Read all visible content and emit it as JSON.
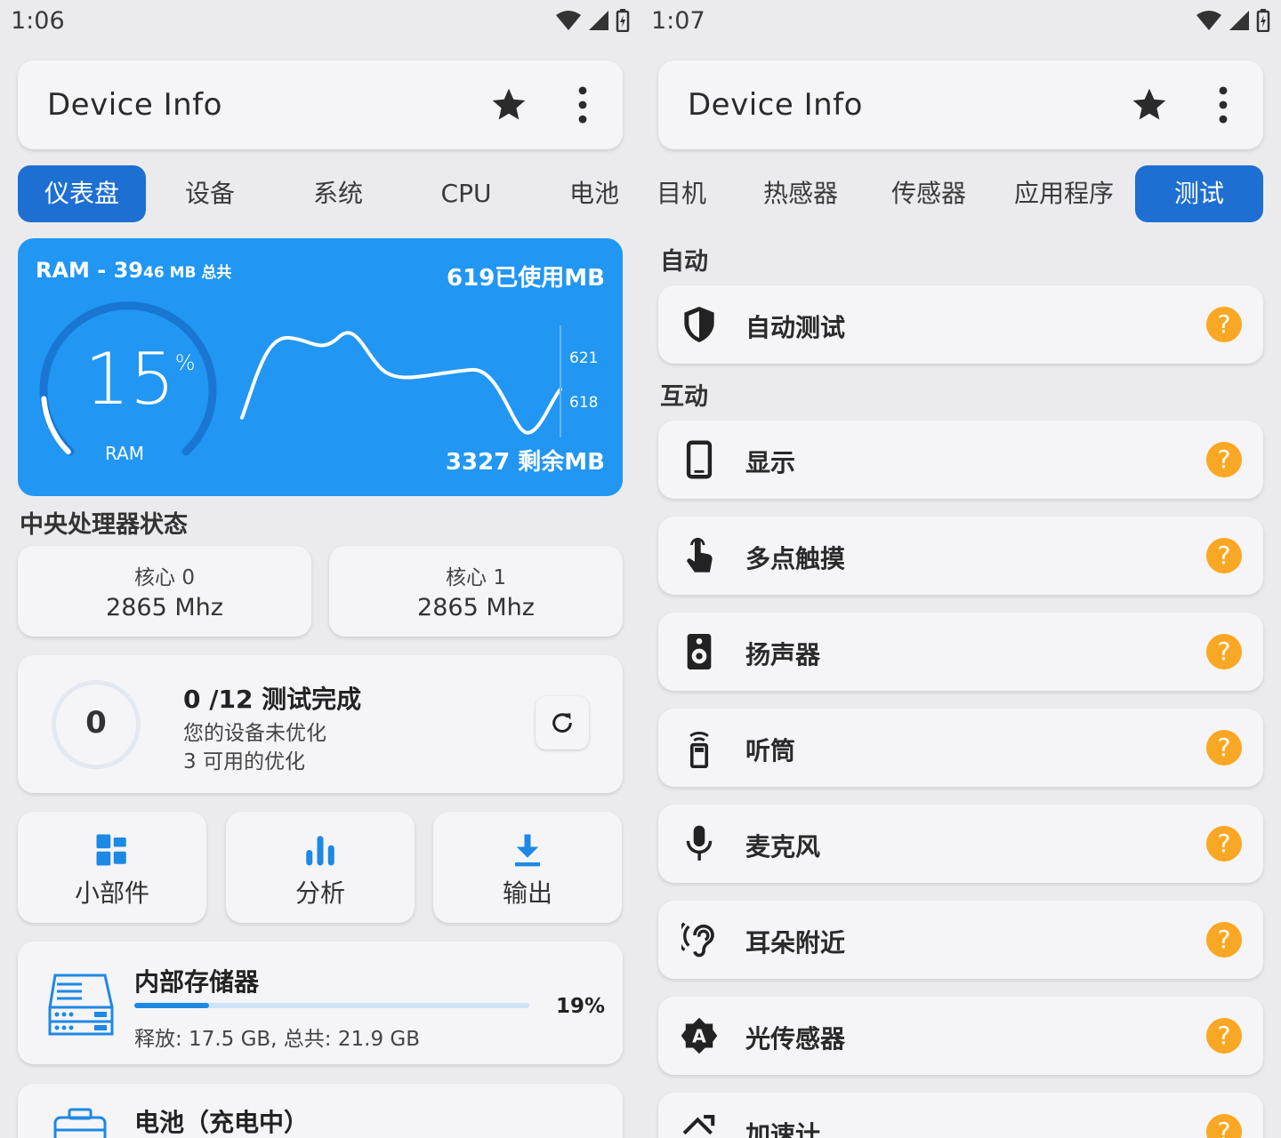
{
  "left": {
    "time": "1:06",
    "app_title": "Device Info",
    "tabs": [
      "仪表盘",
      "设备",
      "系统",
      "CPU",
      "电池"
    ],
    "active_tab": "仪表盘",
    "ram": {
      "title": "RAM - 39",
      "title_small": "46 MB 总共",
      "used": "619已使用MB",
      "free": "3327 剩余MB",
      "percent": "15",
      "percent_sign": "%",
      "label": "RAM",
      "tick_high": "621",
      "tick_low": "618",
      "gauge_fraction": 0.15
    },
    "cpu_section_title": "中央处理器状态",
    "cores": [
      {
        "label": "核心 0",
        "value": "2865 Mhz"
      },
      {
        "label": "核心 1",
        "value": "2865 Mhz"
      }
    ],
    "tests": {
      "count": "0",
      "title": "0 /12 测试完成",
      "line1": "您的设备未优化",
      "line2": "3 可用的优化"
    },
    "actions": [
      "小部件",
      "分析",
      "输出"
    ],
    "storage": {
      "title": "内部存储器",
      "percent": "19%",
      "fraction": 0.19,
      "detail": "释放: 17.5 GB,  总共: 21.9 GB"
    },
    "battery": {
      "title": "电池（充电中）"
    }
  },
  "right": {
    "time": "1:07",
    "app_title": "Device Info",
    "tabs": [
      "目机",
      "热感器",
      "传感器",
      "应用程序",
      "测试"
    ],
    "active_tab": "测试",
    "sections": {
      "auto": "自动",
      "interactive": "互动"
    },
    "auto_items": [
      {
        "label": "自动测试",
        "icon": "shield-icon"
      }
    ],
    "interactive_items": [
      {
        "label": "显示",
        "icon": "phone-icon"
      },
      {
        "label": "多点触摸",
        "icon": "touch-icon"
      },
      {
        "label": "扬声器",
        "icon": "speaker-icon"
      },
      {
        "label": "听筒",
        "icon": "earpiece-icon"
      },
      {
        "label": "麦克风",
        "icon": "microphone-icon"
      },
      {
        "label": "耳朵附近",
        "icon": "ear-icon"
      },
      {
        "label": "光传感器",
        "icon": "light-sensor-icon"
      },
      {
        "label": "加速计",
        "icon": "accelerometer-icon"
      }
    ],
    "help_glyph": "?"
  },
  "colors": {
    "accent": "#1d6fd1",
    "ram_card": "#2196f3",
    "help": "#f9a825",
    "storage_bar": "#1e88e5"
  }
}
